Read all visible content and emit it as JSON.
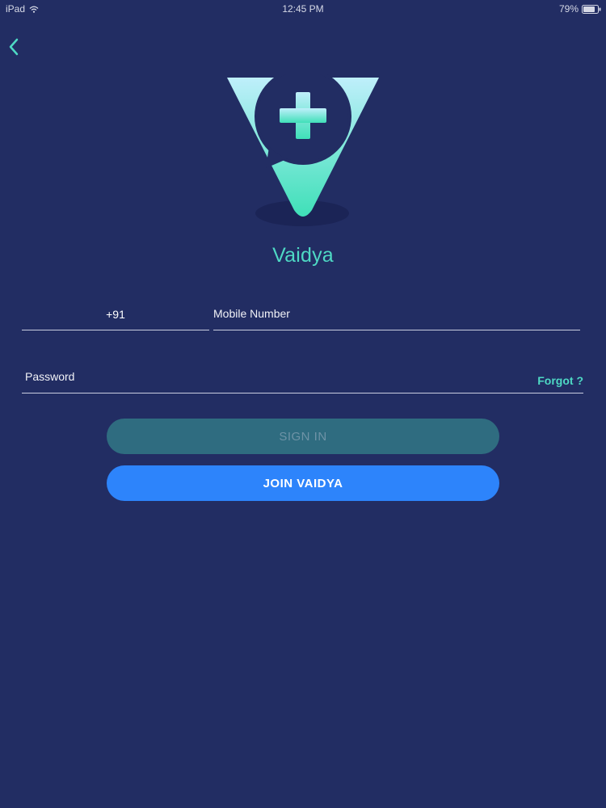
{
  "status_bar": {
    "device": "iPad",
    "time": "12:45 PM",
    "battery": "79%"
  },
  "brand": {
    "app_name": "Vaidya",
    "accent_color": "#4ed9c4",
    "background_color": "#222d63"
  },
  "login_form": {
    "country_code": "+91",
    "mobile_placeholder": "Mobile Number",
    "password_placeholder": "Password",
    "forgot_label": "Forgot ?",
    "signin_label": "SIGN IN",
    "join_label": "JOIN VAIDYA"
  }
}
